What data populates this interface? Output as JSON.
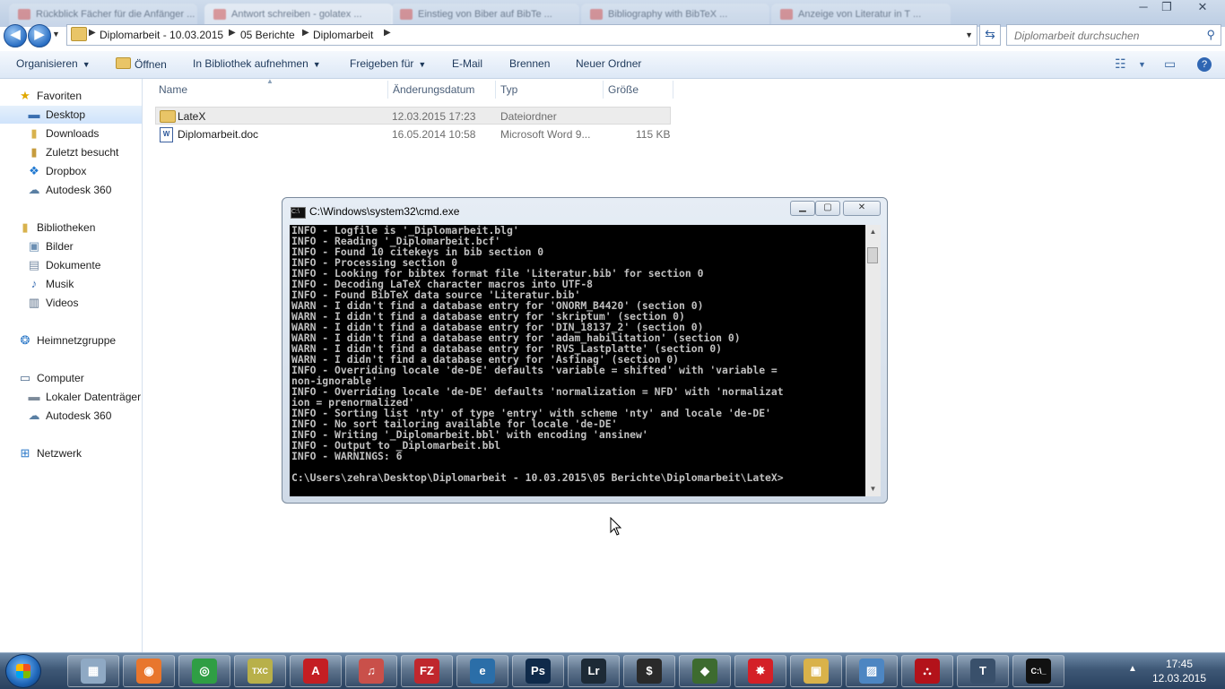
{
  "browser_tabs": [
    {
      "label": "Rückblick Fächer für die Anfänger ..."
    },
    {
      "label": "Antwort schreiben - golatex ..."
    },
    {
      "label": "Einstieg von Biber auf BibTe ..."
    },
    {
      "label": "Bibliography with BibTeX ..."
    },
    {
      "label": "Anzeige von Literatur in T ..."
    }
  ],
  "window_controls": {
    "minimize": "─",
    "maximize": "❐",
    "close": "✕"
  },
  "address": {
    "crumbs": [
      "Diplomarbeit - 10.03.2015",
      "05 Berichte",
      "Diplomarbeit"
    ]
  },
  "search": {
    "placeholder": "Diplomarbeit durchsuchen"
  },
  "commands": {
    "organize": "Organisieren",
    "open": "Öffnen",
    "include_library": "In Bibliothek aufnehmen",
    "share": "Freigeben für",
    "email": "E-Mail",
    "burn": "Brennen",
    "new_folder": "Neuer Ordner"
  },
  "nav": {
    "favorites": "Favoriten",
    "desktop": "Desktop",
    "downloads": "Downloads",
    "recent": "Zuletzt besucht",
    "dropbox": "Dropbox",
    "autodesk": "Autodesk 360",
    "libraries": "Bibliotheken",
    "pictures": "Bilder",
    "documents": "Dokumente",
    "music": "Musik",
    "videos": "Videos",
    "homegroup": "Heimnetzgruppe",
    "computer": "Computer",
    "local_disk": "Lokaler Datenträger",
    "autodesk2": "Autodesk 360",
    "network": "Netzwerk"
  },
  "columns": {
    "name": "Name",
    "date": "Änderungsdatum",
    "type": "Typ",
    "size": "Größe"
  },
  "files": [
    {
      "name": "LateX",
      "date": "12.03.2015 17:23",
      "type": "Dateiordner",
      "size": ""
    },
    {
      "name": "Diplomarbeit.doc",
      "date": "16.05.2014 10:58",
      "type": "Microsoft Word 9...",
      "size": "115 KB"
    }
  ],
  "cmd": {
    "title": "C:\\Windows\\system32\\cmd.exe",
    "lines": [
      "INFO - Logfile is '_Diplomarbeit.blg'",
      "INFO - Reading '_Diplomarbeit.bcf'",
      "INFO - Found 10 citekeys in bib section 0",
      "INFO - Processing section 0",
      "INFO - Looking for bibtex format file 'Literatur.bib' for section 0",
      "INFO - Decoding LaTeX character macros into UTF-8",
      "INFO - Found BibTeX data source 'Literatur.bib'",
      "WARN - I didn't find a database entry for 'ONORM_B4420' (section 0)",
      "WARN - I didn't find a database entry for 'skriptum' (section 0)",
      "WARN - I didn't find a database entry for 'DIN_18137_2' (section 0)",
      "WARN - I didn't find a database entry for 'adam_habilitation' (section 0)",
      "WARN - I didn't find a database entry for 'RVS_Lastplatte' (section 0)",
      "WARN - I didn't find a database entry for 'Asfinag' (section 0)",
      "INFO - Overriding locale 'de-DE' defaults 'variable = shifted' with 'variable =",
      "non-ignorable'",
      "INFO - Overriding locale 'de-DE' defaults 'normalization = NFD' with 'normalizat",
      "ion = prenormalized'",
      "INFO - Sorting list 'nty' of type 'entry' with scheme 'nty' and locale 'de-DE'",
      "INFO - No sort tailoring available for locale 'de-DE'",
      "INFO - Writing '_Diplomarbeit.bbl' with encoding 'ansinew'",
      "INFO - Output to _Diplomarbeit.bbl",
      "INFO - WARNINGS: 6",
      "",
      "C:\\Users\\zehra\\Desktop\\Diplomarbeit - 10.03.2015\\05 Berichte\\Diplomarbeit\\LateX>"
    ]
  },
  "taskbar": {
    "apps": [
      {
        "name": "calculator-icon",
        "glyph": "▦",
        "color": "#8fa9c4"
      },
      {
        "name": "firefox-icon",
        "glyph": "◉",
        "color": "#e8762d"
      },
      {
        "name": "chrome-icon",
        "glyph": "◎",
        "color": "#2f9e44"
      },
      {
        "name": "texmaker-icon",
        "glyph": "TXC",
        "color": "#b8b04a"
      },
      {
        "name": "autocad-icon",
        "glyph": "A",
        "color": "#c41e23"
      },
      {
        "name": "itunes-icon",
        "glyph": "♫",
        "color": "#c9504a"
      },
      {
        "name": "filezilla-icon",
        "glyph": "FZ",
        "color": "#c0272d"
      },
      {
        "name": "ie-icon",
        "glyph": "e",
        "color": "#2b6ea8"
      },
      {
        "name": "photoshop-icon",
        "glyph": "Ps",
        "color": "#0f2a4a"
      },
      {
        "name": "lightroom-icon",
        "glyph": "Lr",
        "color": "#1d2a36"
      },
      {
        "name": "mass-icon",
        "glyph": "$",
        "color": "#2a2a2a"
      },
      {
        "name": "game-icon",
        "glyph": "◆",
        "color": "#3d6b2f"
      },
      {
        "name": "splash-icon",
        "glyph": "✸",
        "color": "#d42027"
      },
      {
        "name": "explorer-icon",
        "glyph": "▣",
        "color": "#d9b24a"
      },
      {
        "name": "photos-icon",
        "glyph": "▨",
        "color": "#4d86c2"
      },
      {
        "name": "acrobat-icon",
        "glyph": "⛬",
        "color": "#b3121a"
      },
      {
        "name": "texworks-icon",
        "glyph": "T",
        "color": "#39506b"
      },
      {
        "name": "cmd-icon",
        "glyph": "C:\\_",
        "color": "#111111"
      }
    ],
    "time": "17:45",
    "date": "12.03.2015"
  }
}
